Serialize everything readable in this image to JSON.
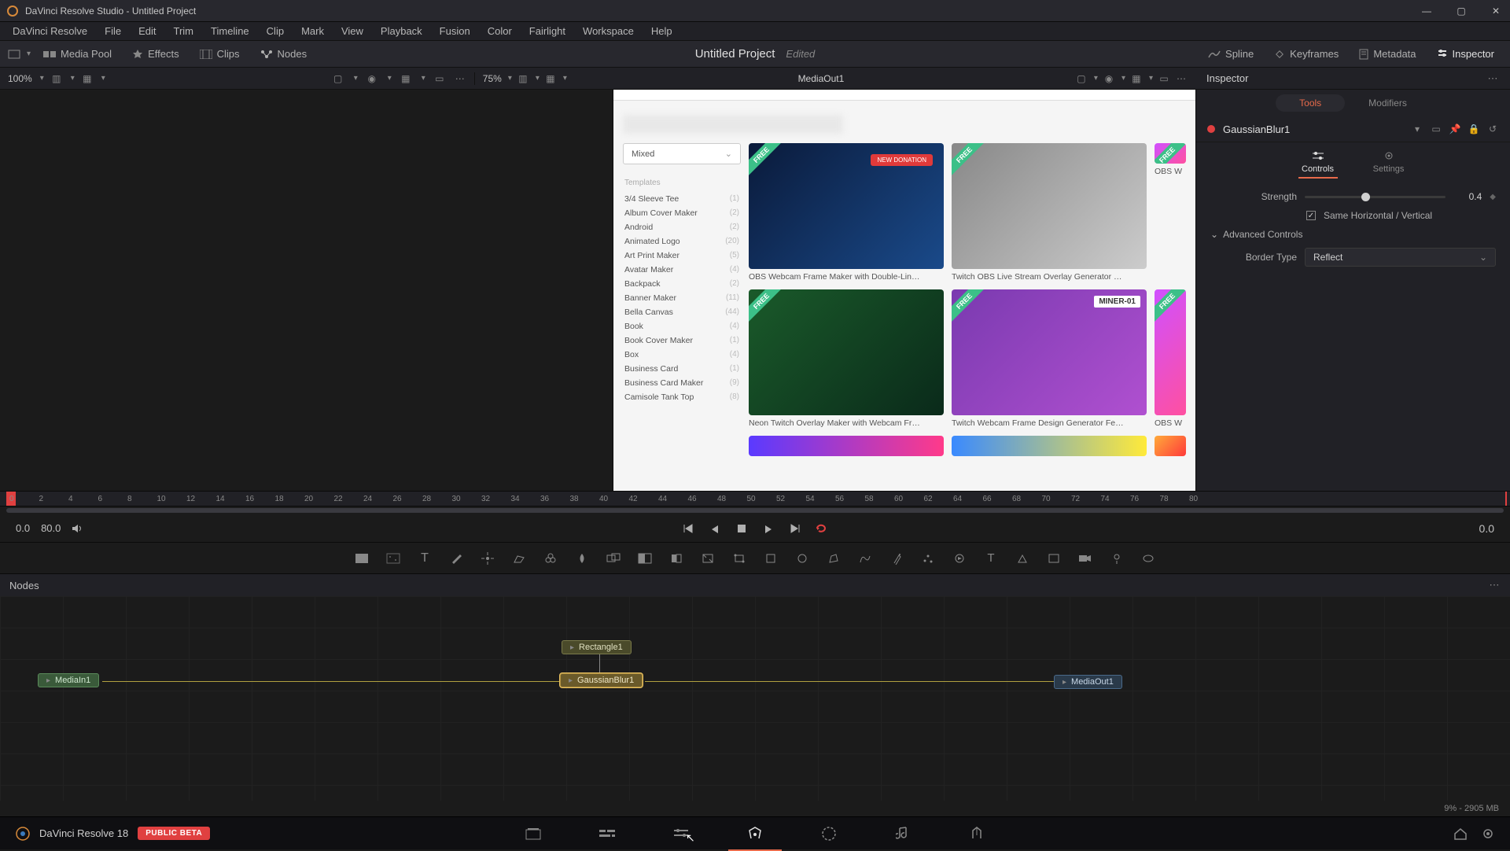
{
  "titlebar": {
    "title": "DaVinci Resolve Studio - Untitled Project"
  },
  "menus": [
    "DaVinci Resolve",
    "File",
    "Edit",
    "Trim",
    "Timeline",
    "Clip",
    "Mark",
    "View",
    "Playback",
    "Fusion",
    "Color",
    "Fairlight",
    "Workspace",
    "Help"
  ],
  "top_toolbar": {
    "left": [
      {
        "label": "Media Pool",
        "icon": "media-pool"
      },
      {
        "label": "Effects",
        "icon": "effects"
      },
      {
        "label": "Clips",
        "icon": "clips"
      },
      {
        "label": "Nodes",
        "icon": "nodes"
      }
    ],
    "project_title": "Untitled Project",
    "project_status": "Edited",
    "right": [
      {
        "label": "Spline",
        "icon": "spline"
      },
      {
        "label": "Keyframes",
        "icon": "keyframes"
      },
      {
        "label": "Metadata",
        "icon": "metadata"
      },
      {
        "label": "Inspector",
        "icon": "inspector"
      }
    ]
  },
  "viewer": {
    "left_zoom": "100%",
    "center_zoom": "75%",
    "center_name": "MediaOut1",
    "inspector_label": "Inspector"
  },
  "browser": {
    "dropdown": "Mixed",
    "templates_header": "Templates",
    "templates": [
      {
        "name": "3/4 Sleeve Tee",
        "count": "(1)"
      },
      {
        "name": "Album Cover Maker",
        "count": "(2)"
      },
      {
        "name": "Android",
        "count": "(2)"
      },
      {
        "name": "Animated Logo",
        "count": "(20)"
      },
      {
        "name": "Art Print Maker",
        "count": "(5)"
      },
      {
        "name": "Avatar Maker",
        "count": "(4)"
      },
      {
        "name": "Backpack",
        "count": "(2)"
      },
      {
        "name": "Banner Maker",
        "count": "(11)"
      },
      {
        "name": "Bella Canvas",
        "count": "(44)"
      },
      {
        "name": "Book",
        "count": "(4)"
      },
      {
        "name": "Book Cover Maker",
        "count": "(1)"
      },
      {
        "name": "Box",
        "count": "(4)"
      },
      {
        "name": "Business Card",
        "count": "(1)"
      },
      {
        "name": "Business Card Maker",
        "count": "(9)"
      },
      {
        "name": "Camisole Tank Top",
        "count": "(8)"
      }
    ],
    "thumbs": [
      {
        "label": "OBS Webcam Frame Maker with Double-Lin…",
        "cls": "a",
        "badge": "FREE",
        "tag": "NEW DONATION",
        "tag_type": "donation"
      },
      {
        "label": "Twitch OBS Live Stream Overlay Generator …",
        "cls": "b",
        "badge": "FREE"
      },
      {
        "label": "OBS W",
        "cls": "partial",
        "badge": "FREE"
      },
      {
        "label": "Neon Twitch Overlay Maker with Webcam Fr…",
        "cls": "c",
        "badge": "FREE"
      },
      {
        "label": "Twitch Webcam Frame Design Generator Fe…",
        "cls": "d",
        "badge": "FREE",
        "tag": "MINER-01",
        "tag_type": "miner"
      },
      {
        "label": "OBS W",
        "cls": "partial2",
        "badge": "FREE"
      }
    ]
  },
  "inspector": {
    "tabs": [
      "Tools",
      "Modifiers"
    ],
    "node_name": "GaussianBlur1",
    "mode_tabs": [
      "Controls",
      "Settings"
    ],
    "strength_label": "Strength",
    "strength_value": "0.4",
    "same_hv": "Same Horizontal / Vertical",
    "advanced": "Advanced Controls",
    "border_label": "Border Type",
    "border_value": "Reflect"
  },
  "ruler_ticks": [
    "0",
    "2",
    "4",
    "6",
    "8",
    "10",
    "12",
    "14",
    "16",
    "18",
    "20",
    "22",
    "24",
    "26",
    "28",
    "30",
    "32",
    "34",
    "36",
    "38",
    "40",
    "42",
    "44",
    "46",
    "48",
    "50",
    "52",
    "54",
    "56",
    "58",
    "60",
    "62",
    "64",
    "66",
    "68",
    "70",
    "72",
    "74",
    "76",
    "78",
    "80"
  ],
  "transport": {
    "start": "0.0",
    "end": "80.0",
    "right": "0.0"
  },
  "nodes_panel": {
    "title": "Nodes"
  },
  "nodes": {
    "media_in": "MediaIn1",
    "rect": "Rectangle1",
    "gauss": "GaussianBlur1",
    "media_out": "MediaOut1"
  },
  "status": {
    "memory": "9% - 2905 MB"
  },
  "page_switcher": {
    "app": "DaVinci Resolve 18",
    "badge": "PUBLIC BETA"
  }
}
